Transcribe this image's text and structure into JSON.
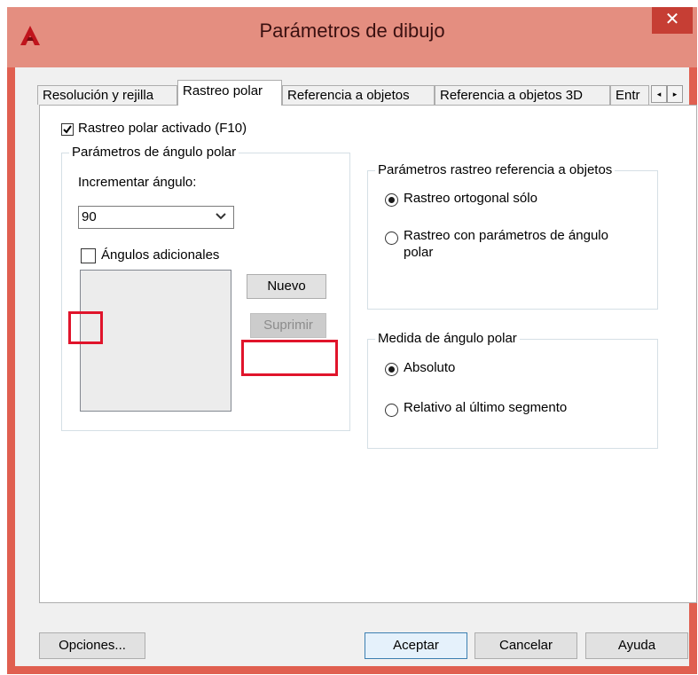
{
  "window": {
    "title": "Parámetros de dibujo",
    "close_symbol": "✕",
    "app_icon": "autocad-logo-icon"
  },
  "tabs": [
    {
      "label": "Resolución y rejilla",
      "active": false
    },
    {
      "label": "Rastreo polar",
      "active": true
    },
    {
      "label": "Referencia a objetos",
      "active": false
    },
    {
      "label": "Referencia a objetos 3D",
      "active": false
    },
    {
      "label": "Entr",
      "active": false
    }
  ],
  "tab_scroll": {
    "left": "◂",
    "right": "▸"
  },
  "polar_tracking": {
    "enabled_label": "Rastreo polar activado (F10)",
    "enabled": true
  },
  "polar_angle_settings": {
    "title": "Parámetros de ángulo polar",
    "increment_label": "Incrementar ángulo:",
    "increment_value": "90",
    "additional_angles_label": "Ángulos adicionales",
    "additional_angles_checked": false,
    "new_button": "Nuevo",
    "delete_button": "Suprimir"
  },
  "object_snap_tracking": {
    "title": "Parámetros rastreo referencia a objetos",
    "options": [
      {
        "label": "Rastreo ortogonal sólo",
        "selected": true
      },
      {
        "label": "Rastreo con parámetros de ángulo",
        "label2": "polar",
        "selected": false
      }
    ]
  },
  "polar_angle_measurement": {
    "title": "Medida de ángulo polar",
    "options": [
      {
        "label": "Absoluto",
        "selected": true
      },
      {
        "label": "Relativo al último segmento",
        "selected": false
      }
    ]
  },
  "footer": {
    "options_button": "Opciones...",
    "ok_button": "Aceptar",
    "cancel_button": "Cancelar",
    "help_button": "Ayuda"
  },
  "colors": {
    "titlebar": "#e48e80",
    "close": "#c63e34",
    "highlight": "#e0142b"
  }
}
